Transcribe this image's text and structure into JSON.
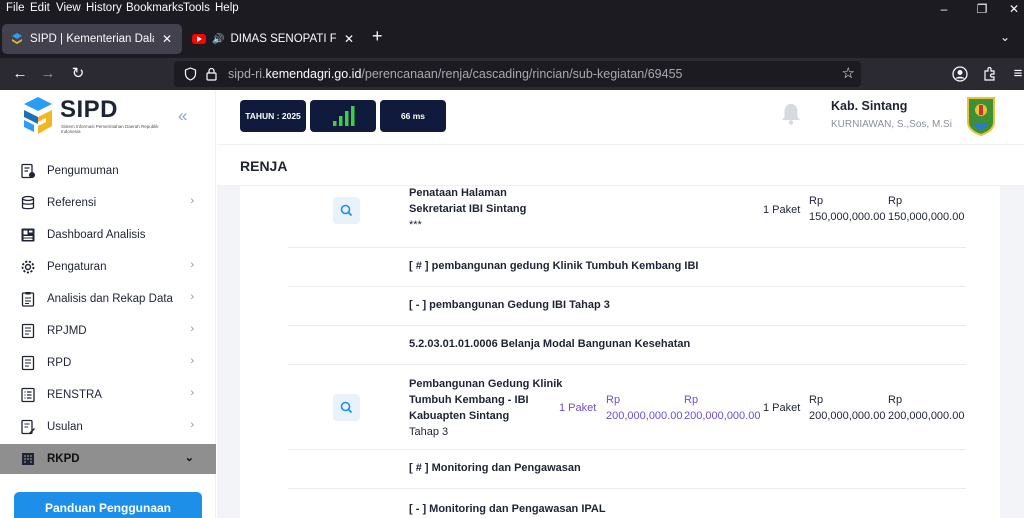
{
  "browser": {
    "menu": [
      "File",
      "Edit",
      "View",
      "History",
      "Bookmarks",
      "Tools",
      "Help"
    ],
    "tabs": [
      {
        "title": "SIPD | Kementerian Dalam Negeri"
      },
      {
        "title": "DIMAS SENOPATI FULL ALBUM"
      }
    ],
    "url_prefix": "sipd-ri.",
    "url_domain": "kemendagri.go.id",
    "url_path": "/perencanaan/renja/cascading/rincian/sub-kegiatan/69455"
  },
  "sidebar": {
    "logo_text": "SIPD",
    "logo_subtitle": "Sistem Informasi Pemerintahan Daerah Republik Indonesia",
    "items": [
      {
        "label": "Pengumuman",
        "icon": "announcement-icon",
        "has_children": false
      },
      {
        "label": "Referensi",
        "icon": "database-icon",
        "has_children": true
      },
      {
        "label": "Dashboard Analisis",
        "icon": "dashboard-icon",
        "has_children": false
      },
      {
        "label": "Pengaturan",
        "icon": "gear-icon",
        "has_children": true
      },
      {
        "label": "Analisis dan Rekap Data",
        "icon": "clipboard-icon",
        "has_children": true
      },
      {
        "label": "RPJMD",
        "icon": "document-icon",
        "has_children": true
      },
      {
        "label": "RPD",
        "icon": "document-icon",
        "has_children": true
      },
      {
        "label": "RENSTRA",
        "icon": "list-icon",
        "has_children": true
      },
      {
        "label": "Usulan",
        "icon": "edit-document-icon",
        "has_children": true
      },
      {
        "label": "RKPD",
        "icon": "building-icon",
        "has_children": true,
        "active": true
      }
    ],
    "guide_button": "Panduan Penggunaan"
  },
  "header": {
    "year_label": "TAHUN : 2025",
    "ping_label": "66 ms",
    "signal_level": 4,
    "user_region": "Kab. Sintang",
    "user_name": "KURNIAWAN, S.,Sos, M.Si"
  },
  "page_title": "RENJA",
  "rows": [
    {
      "type": "item",
      "name_lines": [
        "Penataan Halaman",
        "Sekretariat IBI Sintang"
      ],
      "sub": "***",
      "paket_right": "1 Paket",
      "rp_a": "Rp",
      "val_a": "150,000,000.00",
      "rp_b": "Rp",
      "val_b": "150,000,000.00"
    },
    {
      "type": "group",
      "text": "[ # ] pembangunan gedung Klinik Tumbuh Kembang IBI"
    },
    {
      "type": "group",
      "text": "[ - ] pembangunan Gedung IBI Tahap 3"
    },
    {
      "type": "group",
      "text": "5.2.03.01.01.0006 Belanja Modal Bangunan Kesehatan"
    },
    {
      "type": "item",
      "name_lines": [
        "Pembangunan Gedung Klinik",
        "Tumbuh Kembang - IBI",
        "Kabuapten Sintang"
      ],
      "sub": "Tahap 3",
      "paket_left": "1 Paket",
      "rp_p1": "Rp",
      "val_p1": "200,000,000.00",
      "rp_p2": "Rp",
      "val_p2": "200,000,000.00",
      "paket_right": "1 Paket",
      "rp_a": "Rp",
      "val_a": "200,000,000.00",
      "rp_b": "Rp",
      "val_b": "200,000,000.00"
    },
    {
      "type": "group",
      "text": "[ # ] Monitoring dan Pengawasan"
    },
    {
      "type": "group",
      "text": "[ - ] Monitoring dan Pengawasan IPAL"
    }
  ]
}
